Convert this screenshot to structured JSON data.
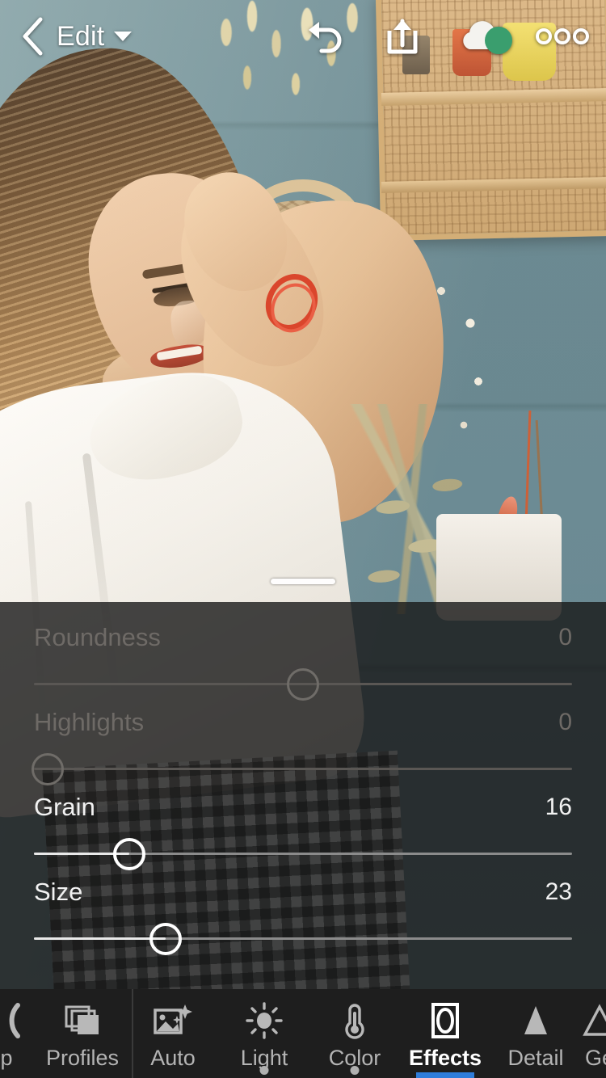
{
  "app": {
    "screen_name": "Lightroom Edit"
  },
  "topbar": {
    "back_icon": "chevron-left-icon",
    "title": "Edit",
    "dropdown_icon": "caret-down-icon",
    "undo_icon": "undo-icon",
    "share_icon": "share-export-icon",
    "sync_icon": "cloud-sync-icon",
    "sync_status_color": "#3a9e6e",
    "more_icon": "more-options-icon"
  },
  "photo": {
    "drag_handle": "photo-resize-handle"
  },
  "panel": {
    "sliders": [
      {
        "label": "Roundness",
        "value": "0",
        "pos": 50.0,
        "fill_from": 50.0,
        "state": "dim"
      },
      {
        "label": "Highlights",
        "value": "0",
        "pos": 2.5,
        "fill_from": 2.5,
        "state": "dim"
      },
      {
        "label": "Grain",
        "value": "16",
        "pos": 17.7,
        "fill_from": 0.0,
        "state": "active"
      },
      {
        "label": "Size",
        "value": "23",
        "pos": 24.5,
        "fill_from": 0.0,
        "state": "active"
      }
    ]
  },
  "bottomnav": {
    "items": [
      {
        "label": "p",
        "icon": "crop-icon",
        "state": "clipped",
        "badge": "none"
      },
      {
        "label": "Profiles",
        "icon": "profiles-icon",
        "state": "normal",
        "badge": "none"
      },
      {
        "label": "Auto",
        "icon": "auto-icon",
        "state": "normal",
        "badge": "none"
      },
      {
        "label": "Light",
        "icon": "sun-icon",
        "state": "normal",
        "badge": "dot"
      },
      {
        "label": "Color",
        "icon": "thermometer-icon",
        "state": "normal",
        "badge": "dot"
      },
      {
        "label": "Effects",
        "icon": "effects-icon",
        "state": "active",
        "badge": "underline"
      },
      {
        "label": "Detail",
        "icon": "triangle-icon",
        "state": "normal",
        "badge": "none"
      },
      {
        "label": "Ge",
        "icon": "geometry-icon",
        "state": "clipped",
        "badge": "none"
      }
    ],
    "active_color": "#2f7ddb"
  }
}
